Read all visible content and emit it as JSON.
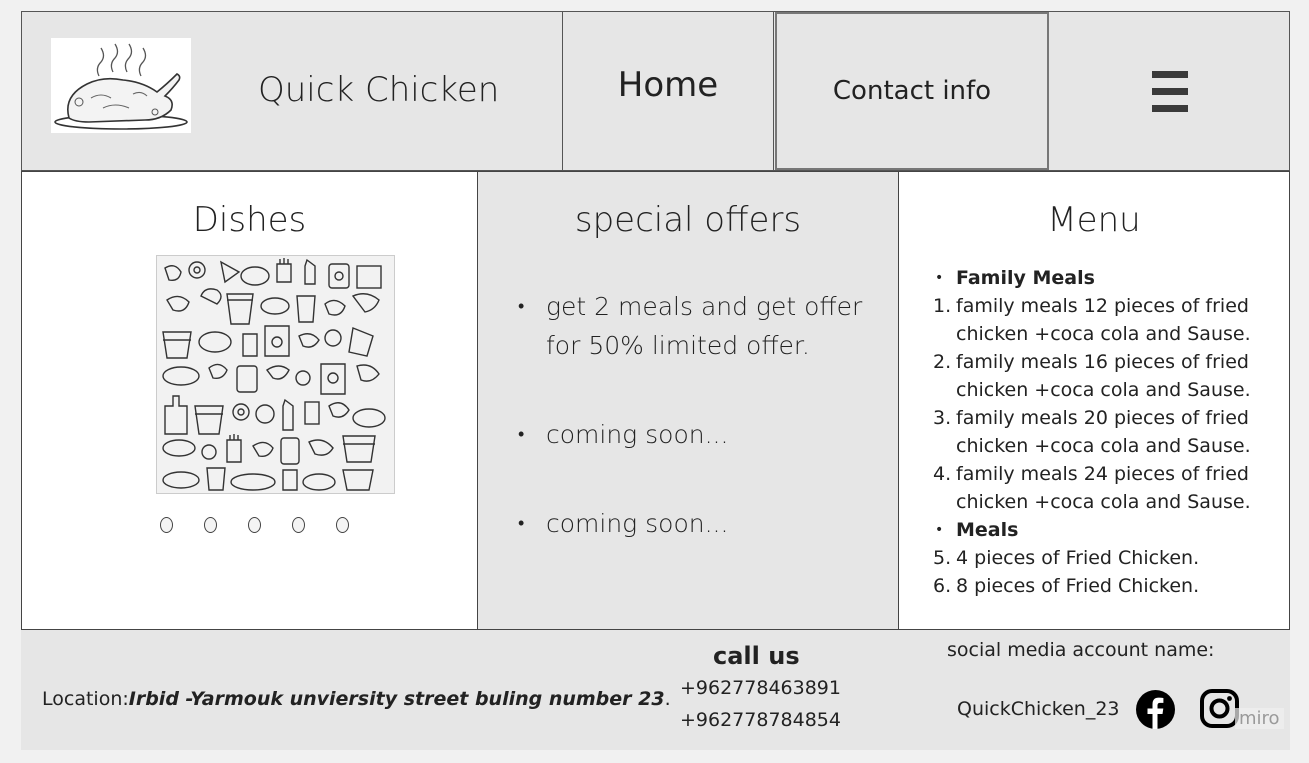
{
  "header": {
    "brand": "Quick Chicken",
    "nav_home": "Home",
    "nav_contact": "Contact info"
  },
  "dishes": {
    "title": "Dishes",
    "slide_count": 5
  },
  "offers": {
    "title": "special offers",
    "items": [
      "get 2 meals and get offer for 50% limited offer.",
      "coming soon...",
      "coming soon..."
    ]
  },
  "menu": {
    "title": "Menu",
    "rows": [
      {
        "marker": "•",
        "text": "Family Meals"
      },
      {
        "marker": "1.",
        "text": "family meals 12 pieces of fried chicken +coca cola and Sause."
      },
      {
        "marker": "2.",
        "text": "family meals 16 pieces of fried chicken +coca cola and Sause."
      },
      {
        "marker": "3.",
        "text": "family meals 20 pieces of fried chicken +coca cola and Sause."
      },
      {
        "marker": "4.",
        "text": "family meals 24 pieces of fried chicken +coca cola and Sause."
      },
      {
        "marker": "•",
        "text": "Meals"
      },
      {
        "marker": "5.",
        "text": "4 pieces of Fried Chicken."
      },
      {
        "marker": "6.",
        "text": "8 pieces of Fried Chicken."
      }
    ]
  },
  "footer": {
    "location_label": "Location:",
    "location_value": "Irbid -Yarmouk unviersity street buling number 23",
    "location_end": ".",
    "call_title": "call us",
    "phone1": "+962778463891",
    "phone2": "+962778784854",
    "social_label": "social media account name:",
    "account": "QuickChicken_23",
    "watermark": "miro"
  },
  "icons": {
    "hamburger": "hamburger-menu-icon",
    "facebook": "facebook-icon",
    "instagram": "instagram-icon"
  },
  "colors": {
    "panel_grey": "#e6e6e6",
    "border": "#444444"
  }
}
